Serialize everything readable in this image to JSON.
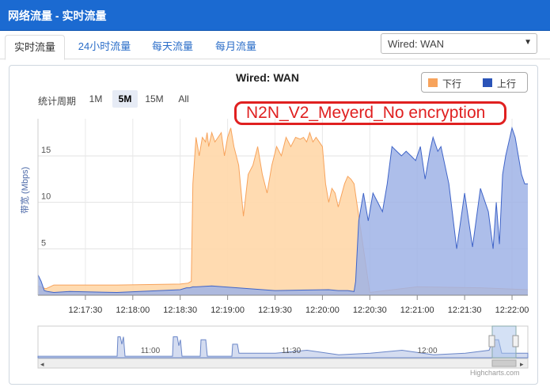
{
  "window": {
    "title": "网络流量 - 实时流量"
  },
  "tabs": [
    {
      "label": "实时流量",
      "active": true
    },
    {
      "label": "24小时流量"
    },
    {
      "label": "每天流量"
    },
    {
      "label": "每月流量"
    }
  ],
  "interface_select": {
    "value": "Wired: WAN"
  },
  "period": {
    "label": "统计周期",
    "options": [
      "1M",
      "5M",
      "15M",
      "All"
    ],
    "selected": "5M"
  },
  "annotation": "N2N_V2_Meyerd_No encryption",
  "credit": "Highcharts.com",
  "chart_data": {
    "type": "area",
    "title": "Wired: WAN",
    "ylabel": "带宽 (Mbps)",
    "ylim": [
      0,
      19
    ],
    "yticks": [
      "5",
      "10",
      "15"
    ],
    "ytick_values": [
      5,
      10,
      15
    ],
    "xlim": [
      0,
      310
    ],
    "xticks": [
      "12:17:30",
      "12:18:00",
      "12:18:30",
      "12:19:00",
      "12:19:30",
      "12:20:00",
      "12:20:30",
      "12:21:00",
      "12:21:30",
      "12:22:00"
    ],
    "xtick_values": [
      30,
      60,
      90,
      120,
      150,
      180,
      210,
      240,
      270,
      300
    ],
    "grid": true,
    "legend_position": "top-right",
    "colors": {
      "down": "#f7a35c",
      "up": "#3f64c8"
    },
    "series": [
      {
        "name": "下行",
        "x": [
          0,
          5,
          10,
          50,
          90,
          95,
          97,
          98,
          100,
          102,
          104,
          106,
          107,
          108,
          110,
          112,
          114,
          116,
          118,
          120,
          122,
          124,
          127,
          130,
          133,
          136,
          139,
          142,
          145,
          148,
          151,
          154,
          157,
          160,
          163,
          166,
          168,
          170,
          172,
          174,
          176,
          178,
          180,
          182,
          184,
          186,
          188,
          190,
          194,
          196,
          198,
          200,
          210,
          240,
          280,
          310
        ],
        "y": [
          1.0,
          0.7,
          1.1,
          1.1,
          1.2,
          1.3,
          1.5,
          12,
          17,
          15,
          17,
          16.5,
          17.5,
          16,
          17.5,
          16.5,
          17,
          17.5,
          15,
          17,
          18,
          16,
          14,
          8.5,
          13,
          14,
          16,
          13,
          11,
          14,
          16,
          15,
          17,
          16,
          17,
          16.8,
          17,
          16.5,
          17.5,
          16.5,
          17,
          16.5,
          16,
          12,
          10,
          11.5,
          11,
          9.5,
          12,
          12.8,
          12.5,
          12,
          0.3,
          0.9,
          0.8,
          0.6
        ]
      },
      {
        "name": "上行",
        "x": [
          0,
          2,
          4,
          6,
          10,
          20,
          50,
          90,
          94,
          96,
          98,
          100,
          110,
          150,
          184,
          190,
          196,
          200,
          201,
          203,
          206,
          209,
          212,
          215,
          218,
          221,
          224,
          227,
          230,
          233,
          236,
          239,
          242,
          245,
          248,
          250,
          253,
          255,
          260,
          265,
          270,
          275,
          280,
          285,
          288,
          290,
          292,
          294,
          296,
          298,
          300,
          302,
          304,
          306,
          308,
          310
        ],
        "y": [
          2.2,
          1.5,
          0.5,
          0.4,
          0.3,
          0.4,
          0.3,
          0.6,
          0.8,
          0.8,
          0.9,
          0.9,
          1.0,
          0.5,
          0.6,
          0.5,
          0.5,
          0.4,
          1.5,
          8,
          11,
          8,
          11,
          10,
          9,
          12,
          16,
          15.5,
          15,
          15.5,
          15,
          14.5,
          16,
          12.5,
          15.5,
          17,
          15.5,
          16,
          12,
          5,
          11,
          5.2,
          11.5,
          9,
          5,
          10,
          5.5,
          13,
          15,
          16.5,
          18,
          17,
          15,
          13,
          12,
          12
        ]
      }
    ]
  }
}
